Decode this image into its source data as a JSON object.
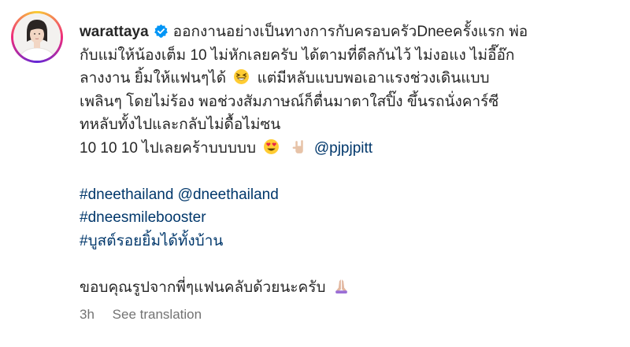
{
  "post": {
    "username": "warattaya",
    "verified_icon": "verified-badge-icon",
    "caption": {
      "line1": "ออกงานอย่างเป็นทางการกับครอบครัวDneeครั้งแรก พ่อ",
      "line2": "กับแม่ให้น้องเต็ม 10 ไม่หักเลยครับ ได้ตามที่ดีลกันไว้ ไม่งอแง ไม่อี๊อ๊ก",
      "line3": "ลางงาน ยิ้มให้แฟนๆได้",
      "line3b": "แต่มีหลับแบบพอเอาแรงช่วงเดินแบบ",
      "line4": "เพลินๆ โดยไม่ร้อง พอช่วงสัมภาษณ์ก็ตื่นมาตาใสปิ๊ง ขึ้นรถนั่งคาร์ซี",
      "line5": "ทหลับทั้งไปและกลับไม่ดื้อไม่ซน",
      "line6": "10 10 10 ไปเลยคร้าบบบบบ",
      "mention": "@pjpjpitt",
      "hashtag1": "#dneethailand",
      "mention2": "@dneethailand",
      "hashtag2": "#dneesmilebooster",
      "hashtag3": "#บูสต์รอยยิ้มได้ทั้งบ้าน",
      "thanks": "ขอบคุณรูปจากพี่ๆแฟนคลับด้วยนะครับ"
    },
    "emojis": [
      "grinning-squinting-face-icon",
      "smiling-face-with-heart-eyes-icon",
      "love-you-gesture-icon",
      "folded-hands-icon"
    ],
    "meta": {
      "time": "3h",
      "translate": "See translation"
    }
  },
  "colors": {
    "text": "#262626",
    "link": "#00376b",
    "muted": "#737373",
    "verified": "#0095f6"
  }
}
